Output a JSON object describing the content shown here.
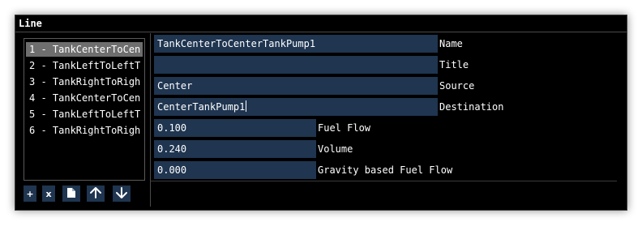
{
  "window": {
    "title": "Line"
  },
  "list": {
    "items": [
      {
        "label": "1 - TankCenterToCen",
        "selected": true
      },
      {
        "label": "2 - TankLeftToLeftT",
        "selected": false
      },
      {
        "label": "3 - TankRightToRigh",
        "selected": false
      },
      {
        "label": "4 - TankCenterToCen",
        "selected": false
      },
      {
        "label": "5 - TankLeftToLeftT",
        "selected": false
      },
      {
        "label": "6 - TankRightToRigh",
        "selected": false
      }
    ]
  },
  "toolbar": {
    "add_label": "+",
    "remove_label": "x",
    "copy_icon": "copy-icon",
    "up_icon": "arrow-up-icon",
    "down_icon": "arrow-down-icon"
  },
  "properties": {
    "name": {
      "label": "Name",
      "value": "TankCenterToCenterTankPump1"
    },
    "title": {
      "label": "Title",
      "value": ""
    },
    "source": {
      "label": "Source",
      "value": "Center"
    },
    "destination": {
      "label": "Destination",
      "value": "CenterTankPump1"
    },
    "fuel_flow": {
      "label": "Fuel Flow",
      "value": "0.100"
    },
    "volume": {
      "label": "Volume",
      "value": "0.240"
    },
    "gravity_fuel_flow": {
      "label": "Gravity based Fuel Flow",
      "value": "0.000"
    }
  },
  "colors": {
    "background": "#000000",
    "field": "#1f3550",
    "selected_row": "#6e6e6e",
    "text": "#ffffff"
  }
}
